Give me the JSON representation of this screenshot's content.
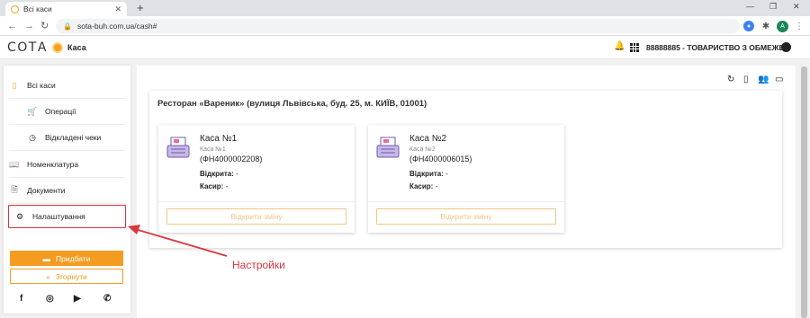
{
  "browser": {
    "tab_title": "Всі каси",
    "url": "sota-buh.com.ua/cash#",
    "profile_initial": "A"
  },
  "header": {
    "logo": "СОТА",
    "app_title": "Каса",
    "org": "88888885 - ТОВАРИСТВО З ОБМЕЖЕ..."
  },
  "sidebar": {
    "items": [
      {
        "label": "Всі каси",
        "icon": "register-icon"
      },
      {
        "label": "Операції",
        "icon": "cart-icon"
      },
      {
        "label": "Відкладені чеки",
        "icon": "clock-icon"
      },
      {
        "label": "Номенклатура",
        "icon": "book-icon"
      },
      {
        "label": "Документи",
        "icon": "document-icon"
      },
      {
        "label": "Налаштування",
        "icon": "gears-icon"
      }
    ],
    "buy_label": "Придбати",
    "collapse_label": "Згорнути"
  },
  "main": {
    "restaurant": "Ресторан «Вареник» (вулиця Львівська, буд. 25, м. КИЇВ, 01001)",
    "registers": [
      {
        "title": "Каса №1",
        "subtitle": "Каса №1",
        "fn": "(ФН4000002208)",
        "opened_label": "Відкрита:",
        "opened_value": "-",
        "cashier_label": "Касир:",
        "cashier_value": "-",
        "button": "Відкрити зміну"
      },
      {
        "title": "Каса №2",
        "subtitle": "Каса №2",
        "fn": "(ФН4000006015)",
        "opened_label": "Відкрита:",
        "opened_value": "-",
        "cashier_label": "Касир:",
        "cashier_value": "-",
        "button": "Відкрити зміну"
      }
    ]
  },
  "annotation": {
    "text": "Настройки",
    "color": "#d9363e"
  },
  "colors": {
    "accent": "#f39c21",
    "highlight": "#d9363e"
  }
}
